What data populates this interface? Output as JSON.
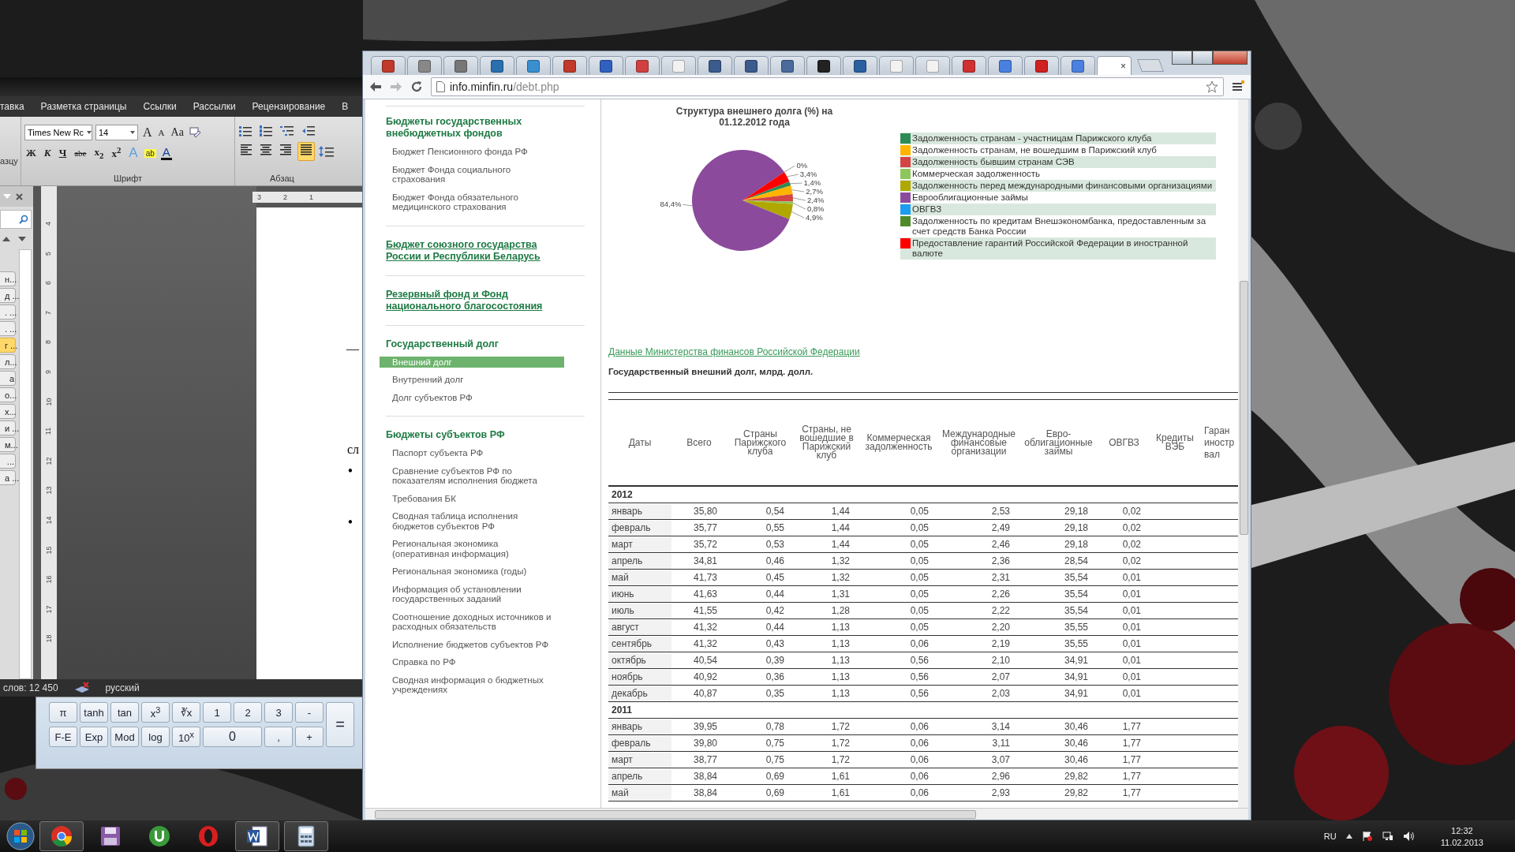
{
  "word": {
    "ribbon_tabs": [
      "тавка",
      "Разметка страницы",
      "Ссылки",
      "Рассылки",
      "Рецензирование",
      "В"
    ],
    "font_name": "Times New Rc",
    "font_size": "14",
    "font_tools": [
      {
        "label": "A",
        "kind": "grow"
      },
      {
        "label": "A",
        "kind": "shrink"
      },
      {
        "label": "Aa",
        "kind": "case"
      }
    ],
    "format_buttons": [
      {
        "label": "Ж",
        "kind": "bold"
      },
      {
        "label": "К",
        "kind": "italic"
      },
      {
        "label": "Ч",
        "kind": "underline"
      },
      {
        "label": "abe",
        "kind": "strike"
      },
      {
        "label": "x$_{2}$",
        "kind": "script"
      },
      {
        "label": "x$^{2}$",
        "kind": "script"
      },
      {
        "label": "A",
        "kind": "effects"
      },
      {
        "label": "ab",
        "kind": "highlight"
      },
      {
        "label": "A",
        "kind": "color"
      }
    ],
    "align_buttons": [
      {
        "selected": false
      },
      {
        "selected": false
      },
      {
        "selected": false
      },
      {
        "selected": true
      }
    ],
    "group_labels": [
      "азцу",
      "Шрифт",
      "Абзац"
    ],
    "nav_items": [
      {
        "text": "н...",
        "selected": false
      },
      {
        "text": "д ...",
        "selected": false
      },
      {
        "text": ". ...",
        "selected": false
      },
      {
        "text": ". ...",
        "selected": false
      },
      {
        "text": "г ...",
        "selected": true
      },
      {
        "text": "л...",
        "selected": false
      },
      {
        "text": "а",
        "selected": false
      },
      {
        "text": "о...",
        "selected": false
      },
      {
        "text": "х...",
        "selected": false
      },
      {
        "text": "и ...",
        "selected": false
      },
      {
        "text": "м...",
        "selected": false
      },
      {
        "text": "...",
        "selected": false
      },
      {
        "text": "а ...",
        "selected": false
      }
    ],
    "ruler_h": [
      "3",
      "2",
      "1"
    ],
    "ruler_v": [
      "4",
      "5",
      "6",
      "7",
      "8",
      "9",
      "10",
      "11",
      "12",
      "13",
      "14",
      "15",
      "16",
      "17",
      "18"
    ],
    "doc_lines": [
      {
        "kind": "text",
        "text": "—"
      },
      {
        "kind": "text",
        "text": "сл"
      },
      {
        "kind": "bullet",
        "text": "•"
      },
      {
        "kind": "bullet",
        "text": "•"
      }
    ],
    "status": {
      "words": "слов: 12 450",
      "language": "русский"
    }
  },
  "calculator": {
    "keys": [
      {
        "label": "π",
        "kind": "key"
      },
      {
        "label": "tanh",
        "kind": "key"
      },
      {
        "label": "tan",
        "kind": "key"
      },
      {
        "label": "x$^{3}$",
        "kind": "key"
      },
      {
        "label": "∛x",
        "kind": "key"
      },
      {
        "label": "1",
        "kind": "key"
      },
      {
        "label": "2",
        "kind": "key"
      },
      {
        "label": "3",
        "kind": "key"
      },
      {
        "label": "-",
        "kind": "key"
      },
      {
        "label": "=",
        "kind": "tall"
      },
      {
        "label": "F-E",
        "kind": "key"
      },
      {
        "label": "Exp",
        "kind": "key"
      },
      {
        "label": "Mod",
        "kind": "key"
      },
      {
        "label": "log",
        "kind": "key"
      },
      {
        "label": "10$^{x}$",
        "kind": "key"
      },
      {
        "label": "0",
        "kind": "wide"
      },
      {
        "label": ",",
        "kind": "key"
      },
      {
        "label": "+",
        "kind": "key"
      }
    ]
  },
  "browser": {
    "tabs": [
      {
        "selected": false
      },
      {
        "selected": false
      },
      {
        "selected": false
      },
      {
        "selected": false
      },
      {
        "selected": false
      },
      {
        "selected": false
      },
      {
        "selected": false
      },
      {
        "selected": false
      },
      {
        "selected": false
      },
      {
        "selected": false
      },
      {
        "selected": false
      },
      {
        "selected": false
      },
      {
        "selected": false
      },
      {
        "selected": false
      },
      {
        "selected": false
      },
      {
        "selected": false
      },
      {
        "selected": false
      },
      {
        "selected": false
      },
      {
        "selected": false
      },
      {
        "selected": false
      },
      {
        "selected": true,
        "close": "×"
      }
    ],
    "address": {
      "host": "info.minfin.ru",
      "path": "/debt.php"
    }
  },
  "sidebar": {
    "sections": [
      {
        "title": "Бюджеты государственных внебюджетных фондов",
        "link": false,
        "items": [
          {
            "text": "Бюджет Пенсионного фонда РФ",
            "selected": false
          },
          {
            "text": "Бюджет Фонда социального страхования",
            "selected": false
          },
          {
            "text": "Бюджет Фонда обязательного медицинского страхования",
            "selected": false
          }
        ]
      },
      {
        "title": "Бюджет союзного государства России и Республики Беларусь",
        "link": true
      },
      {
        "title": "Резервный фонд и Фонд национального благосостояния",
        "link": true
      },
      {
        "title": "Государственный долг",
        "link": false,
        "items": [
          {
            "text": "Внешний долг",
            "selected": true
          },
          {
            "text": "Внутренний долг",
            "selected": false
          },
          {
            "text": "Долг субъектов РФ",
            "selected": false
          }
        ]
      },
      {
        "title": "Бюджеты субъектов РФ",
        "link": false,
        "items": [
          {
            "text": "Паспорт субъекта РФ",
            "selected": false
          },
          {
            "text": "Сравнение субъектов РФ по показателям исполнения бюджета",
            "selected": false
          },
          {
            "text": "Требования БК",
            "selected": false
          },
          {
            "text": "Сводная таблица исполнения бюджетов субъектов РФ",
            "selected": false
          },
          {
            "text": "Региональная экономика (оперативная информация)",
            "selected": false
          },
          {
            "text": "Региональная экономика (годы)",
            "selected": false
          },
          {
            "text": "Информация об установлении государственных заданий",
            "selected": false
          },
          {
            "text": "Соотношение доходных источников и расходных обязательств",
            "selected": false
          },
          {
            "text": "Исполнение бюджетов субъектов РФ",
            "selected": false
          },
          {
            "text": "Справка по РФ",
            "selected": false
          },
          {
            "text": "Сводная информация о бюджетных учреждениях",
            "selected": false
          }
        ]
      }
    ]
  },
  "chart": {
    "chart_data": {
      "type": "pie",
      "title": "Структура внешнего долга (%) на 01.12.2012  года",
      "categories": [
        "Задолженность странам - участницам Парижского клуба",
        "Задолженность странам, не вошедшим в Парижский клуб",
        "Задолженность бывшим странам СЭВ",
        "Коммерческая задолженность",
        "Задолженность перед международными финансовыми организациями",
        "Еврооблигационные займы",
        "ОВГВЗ",
        "Задолженность по кредитам Внешэкономбанка, предоставленным за счет средств Банка России",
        "Предоставление гарантий Российской Федерации в иностранной валюте"
      ],
      "colors": [
        "#2e8b57",
        "#ffb400",
        "#d44444",
        "#8dc65a",
        "#b0a800",
        "#8b4a9c",
        "#1e9cf0",
        "#4f8a2a",
        "#ff0000"
      ],
      "values": [
        1.4,
        2.7,
        2.4,
        0.8,
        4.9,
        84.4,
        0,
        null,
        3.4
      ],
      "legend": "right",
      "value_labels": [
        "1,4%",
        "2,7%",
        "2,4%",
        "0,8%",
        "4,9%",
        "84,4%",
        "0%",
        null,
        "3,4%"
      ]
    }
  },
  "source_link": "Данные Министерства финансов Российской Федерации",
  "table_caption": "Государственный внешний долг, млрд. долл.",
  "table": {
    "columns": [
      "Даты",
      "Всего",
      "Страны Парижского клуба",
      "Страны, не вошедшие в Парижский клуб",
      "Коммерческая задолженность",
      "Международные финансовые организации",
      "Евро-облигационные займы",
      "ОВГВЗ",
      "Кредиты ВЭБ",
      "Гаран иностр вал"
    ],
    "groups": [
      {
        "year": "2012",
        "rows": [
          [
            "январь",
            "35,80",
            "0,54",
            "1,44",
            "0,05",
            "2,53",
            "29,18",
            "0,02"
          ],
          [
            "февраль",
            "35,77",
            "0,55",
            "1,44",
            "0,05",
            "2,49",
            "29,18",
            "0,02"
          ],
          [
            "март",
            "35,72",
            "0,53",
            "1,44",
            "0,05",
            "2,46",
            "29,18",
            "0,02"
          ],
          [
            "апрель",
            "34,81",
            "0,46",
            "1,32",
            "0,05",
            "2,36",
            "28,54",
            "0,02"
          ],
          [
            "май",
            "41,73",
            "0,45",
            "1,32",
            "0,05",
            "2,31",
            "35,54",
            "0,01"
          ],
          [
            "июнь",
            "41,63",
            "0,44",
            "1,31",
            "0,05",
            "2,26",
            "35,54",
            "0,01"
          ],
          [
            "июль",
            "41,55",
            "0,42",
            "1,28",
            "0,05",
            "2,22",
            "35,54",
            "0,01"
          ],
          [
            "август",
            "41,32",
            "0,44",
            "1,13",
            "0,05",
            "2,20",
            "35,55",
            "0,01"
          ],
          [
            "сентябрь",
            "41,32",
            "0,43",
            "1,13",
            "0,06",
            "2,19",
            "35,55",
            "0,01"
          ],
          [
            "октябрь",
            "40,54",
            "0,39",
            "1,13",
            "0,56",
            "2,10",
            "34,91",
            "0,01"
          ],
          [
            "ноябрь",
            "40,92",
            "0,36",
            "1,13",
            "0,56",
            "2,07",
            "34,91",
            "0,01"
          ],
          [
            "декабрь",
            "40,87",
            "0,35",
            "1,13",
            "0,56",
            "2,03",
            "34,91",
            "0,01"
          ]
        ]
      },
      {
        "year": "2011",
        "rows": [
          [
            "январь",
            "39,95",
            "0,78",
            "1,72",
            "0,06",
            "3,14",
            "30,46",
            "1,77"
          ],
          [
            "февраль",
            "39,80",
            "0,75",
            "1,72",
            "0,06",
            "3,11",
            "30,46",
            "1,77"
          ],
          [
            "март",
            "38,77",
            "0,75",
            "1,72",
            "0,06",
            "3,07",
            "30,46",
            "1,77"
          ],
          [
            "апрель",
            "38,84",
            "0,69",
            "1,61",
            "0,06",
            "2,96",
            "29,82",
            "1,77"
          ],
          [
            "май",
            "38,84",
            "0,69",
            "1,61",
            "0,06",
            "2,93",
            "29,82",
            "1,77"
          ]
        ]
      }
    ]
  },
  "taskbar": {
    "apps": [
      {
        "active": true
      },
      {
        "active": false
      },
      {
        "active": false
      },
      {
        "active": false
      },
      {
        "active": true
      },
      {
        "active": true
      }
    ],
    "tray": {
      "language": "RU",
      "time": "12:32",
      "date": "11.02.2013"
    }
  }
}
